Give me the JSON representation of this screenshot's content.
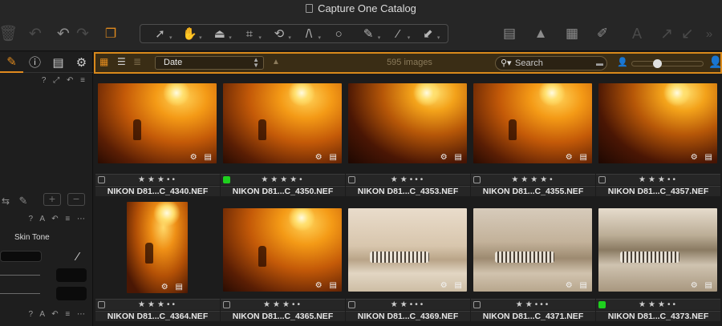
{
  "window": {
    "title": "Capture One Catalog"
  },
  "toolbar": {
    "left_icons": [
      "trash-icon",
      "undo-icon",
      "undo-icon",
      "redo-icon",
      "multi-view-icon"
    ],
    "cursor_tools": [
      "select-icon",
      "pan-icon",
      "straighten-icon",
      "crop-icon",
      "rotate-icon",
      "keystone-icon",
      "circle-icon",
      "brush-icon",
      "picker-icon",
      "eraser-icon"
    ],
    "right_icons": [
      "viewer-icon",
      "warning-icon",
      "grid-icon",
      "brush-icon",
      "text-icon",
      "arrow-up-icon",
      "arrow-down-icon",
      "more-icon"
    ],
    "accent": "#e08a1e"
  },
  "left_panel": {
    "tool_tabs": [
      "brush-tab-icon",
      "info-tab-icon",
      "list-tab-icon",
      "gear-tab-icon"
    ],
    "active_tab": 0,
    "skin_tone_label": "Skin Tone",
    "add_label": "+",
    "remove_label": "−"
  },
  "browser_bar": {
    "sort_by": "Date",
    "image_count": "595 images",
    "search_placeholder": "Search",
    "zoom_level": 0.32,
    "accent": "#d9891b"
  },
  "thumbnails": [
    {
      "filename": "NIKON D81...C_4340.NEF",
      "rating": 3,
      "label": "",
      "scene": "sunset-deer"
    },
    {
      "filename": "NIKON D81...C_4350.NEF",
      "rating": 4,
      "label": "green",
      "scene": "sunset-deer"
    },
    {
      "filename": "NIKON D81...C_4353.NEF",
      "rating": 2,
      "label": "",
      "scene": "sunset-dark"
    },
    {
      "filename": "NIKON D81...C_4355.NEF",
      "rating": 4,
      "label": "",
      "scene": "sunset-deer"
    },
    {
      "filename": "NIKON D81...C_4357.NEF",
      "rating": 3,
      "label": "",
      "scene": "sunset-dark"
    },
    {
      "filename": "NIKON D81...C_4364.NEF",
      "rating": 3,
      "label": "",
      "scene": "sunset-portrait"
    },
    {
      "filename": "NIKON D81...C_4365.NEF",
      "rating": 3,
      "label": "",
      "scene": "sunset-deer"
    },
    {
      "filename": "NIKON D81...C_4369.NEF",
      "rating": 2,
      "label": "",
      "scene": "zebra-light"
    },
    {
      "filename": "NIKON D81...C_4371.NEF",
      "rating": 2,
      "label": "",
      "scene": "zebra-mid"
    },
    {
      "filename": "NIKON D81...C_4373.NEF",
      "rating": 3,
      "label": "green",
      "scene": "zebra-water"
    }
  ]
}
